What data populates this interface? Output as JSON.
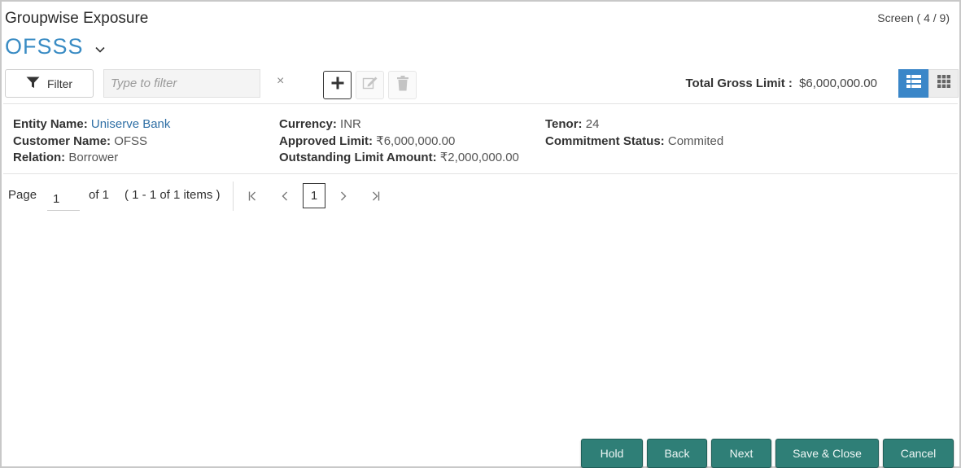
{
  "header": {
    "title": "Groupwise Exposure",
    "screen_indicator": "Screen ( 4 / 9)",
    "entity_selector": "OFSSS"
  },
  "toolbar": {
    "filter_label": "Filter",
    "filter_placeholder": "Type to filter",
    "clear_symbol": "×",
    "add_icon": "plus-icon",
    "edit_icon": "edit-icon",
    "delete_icon": "trash-icon",
    "total_gross_limit_label": "Total Gross Limit :",
    "total_gross_limit_value": "$6,000,000.00",
    "view_list_icon": "list-view-icon",
    "view_grid_icon": "grid-view-icon"
  },
  "record": {
    "entity_name_label": "Entity Name:",
    "entity_name_value": "Uniserve Bank",
    "customer_name_label": "Customer Name:",
    "customer_name_value": "OFSS",
    "relation_label": "Relation:",
    "relation_value": "Borrower",
    "currency_label": "Currency:",
    "currency_value": "INR",
    "approved_limit_label": "Approved Limit:",
    "approved_limit_value": "₹6,000,000.00",
    "outstanding_label": "Outstanding Limit Amount:",
    "outstanding_value": "₹2,000,000.00",
    "tenor_label": "Tenor:",
    "tenor_value": "24",
    "commitment_label": "Commitment Status:",
    "commitment_value": "Commited"
  },
  "pagination": {
    "page_label": "Page",
    "page_value": "1",
    "of_label": "of 1",
    "range_label": "( 1 - 1 of 1 items )",
    "current_page": "1"
  },
  "footer": {
    "hold": "Hold",
    "back": "Back",
    "next": "Next",
    "save_close": "Save & Close",
    "cancel": "Cancel"
  },
  "colors": {
    "accent_blue": "#3a86c8",
    "link_blue": "#2f6fa5",
    "footer_button": "#2f7f77"
  }
}
